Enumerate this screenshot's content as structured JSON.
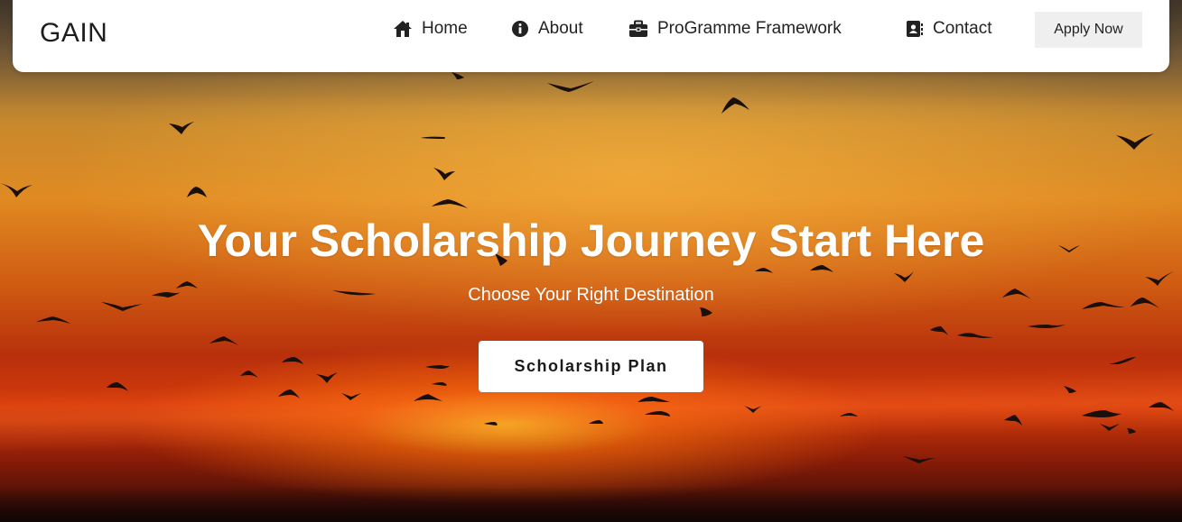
{
  "navbar": {
    "brand": "GAIN",
    "items": [
      {
        "label": "Home",
        "icon": "home-icon"
      },
      {
        "label": "About",
        "icon": "info-icon"
      },
      {
        "label": "ProGramme Framework",
        "icon": "briefcase-icon"
      },
      {
        "label": "Contact",
        "icon": "contact-book-icon"
      }
    ],
    "apply_label": "Apply Now"
  },
  "hero": {
    "title": "Your Scholarship Journey Start Here",
    "subtitle": "Choose Your Right Destination",
    "cta_label": "Scholarship Plan",
    "background": "sunset-sky-with-flying-birds"
  },
  "colors": {
    "navbar_bg": "#ffffff",
    "apply_bg": "#efefef",
    "hero_text": "#ffffff",
    "cta_bg": "#ffffff"
  }
}
